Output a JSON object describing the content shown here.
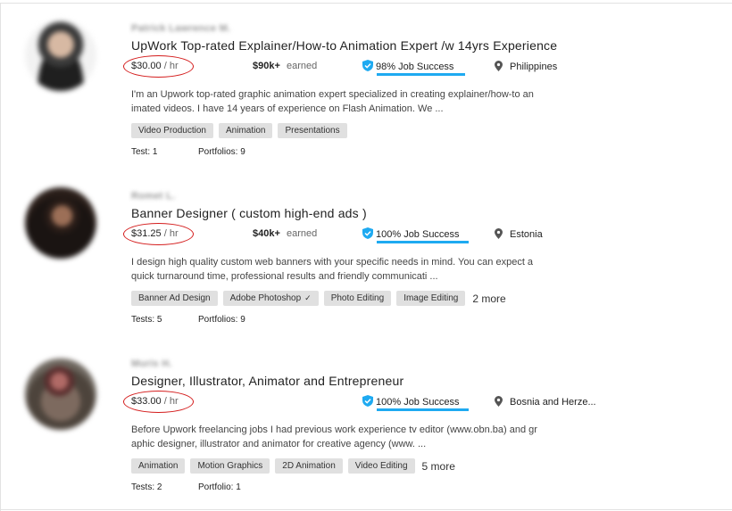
{
  "freelancers": [
    {
      "name": "Patrick Lawrence M.",
      "title": "UpWork Top-rated Explainer/How-to Animation Expert /w 14yrs Experience",
      "rate": "$30.00",
      "rate_unit": "/ hr",
      "earned_amount": "$90k+",
      "earned_label": "earned",
      "job_success": "98% Job Success",
      "location": "Philippines",
      "description_lines": [
        "I'm an Upwork top-rated graphic animation expert specialized in creating explainer/how-to an",
        "imated videos. I have 14 years of experience on Flash Animation. We ..."
      ],
      "skills": [
        "Video Production",
        "Animation",
        "Presentations"
      ],
      "more": "",
      "tests": "Test: 1",
      "portfolios": "Portfolios: 9"
    },
    {
      "name": "Romet L.",
      "title": "Banner Designer ( custom high-end ads )",
      "rate": "$31.25",
      "rate_unit": "/ hr",
      "earned_amount": "$40k+",
      "earned_label": "earned",
      "job_success": "100% Job Success",
      "location": "Estonia",
      "description_lines": [
        "I design high quality custom web banners with your specific needs in mind. You can expect a",
        "quick turnaround time, professional results and friendly communicati ..."
      ],
      "skills": [
        "Banner Ad Design",
        "Adobe Photoshop",
        "Photo Editing",
        "Image Editing"
      ],
      "verified_skill": "Adobe Photoshop",
      "more": "2 more",
      "tests": "Tests: 5",
      "portfolios": "Portfolios: 9"
    },
    {
      "name": "Muris H.",
      "title": "Designer, Illustrator, Animator and Entrepreneur",
      "rate": "$33.00",
      "rate_unit": "/ hr",
      "earned_amount": "",
      "earned_label": "",
      "job_success": "100% Job Success",
      "location": "Bosnia and Herze...",
      "description_lines": [
        "Before Upwork freelancing jobs I had previous work experience tv editor (www.obn.ba) and gr",
        "aphic designer, illustrator and animator for creative agency (www. ..."
      ],
      "skills": [
        "Animation",
        "Motion Graphics",
        "2D Animation",
        "Video Editing"
      ],
      "more": "5 more",
      "tests": "Tests: 2",
      "portfolios": "Portfolio: 1"
    }
  ],
  "colors": {
    "job_success_bar": "#1eaaf1",
    "rate_highlight_ring": "#d41c1c",
    "skill_chip_bg": "#e0e0e0"
  },
  "icons": {
    "job_success": "shield-check-icon",
    "location": "map-pin-icon",
    "verified_skill": "check-icon"
  }
}
